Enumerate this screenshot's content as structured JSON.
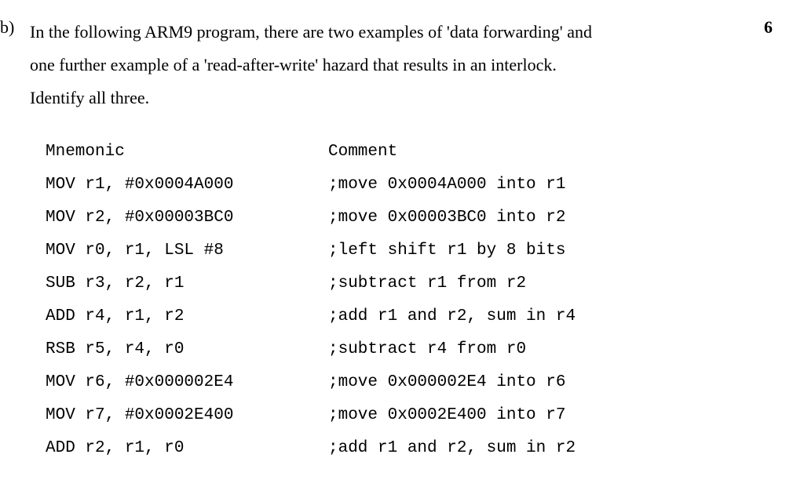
{
  "question": {
    "label": "b)",
    "marks": "6",
    "lines": [
      "In the following ARM9 program, there are two examples of 'data forwarding' and",
      "one further example of a 'read-after-write' hazard that results in an interlock.",
      "Identify all three."
    ]
  },
  "code": {
    "header": {
      "mnemonic": "Mnemonic",
      "comment": "Comment"
    },
    "rows": [
      {
        "mnemonic": "MOV r1, #0x0004A000",
        "comment": ";move 0x0004A000 into r1"
      },
      {
        "mnemonic": "MOV r2, #0x00003BC0",
        "comment": ";move 0x00003BC0 into r2"
      },
      {
        "mnemonic": "MOV r0, r1, LSL #8",
        "comment": ";left shift r1 by 8 bits"
      },
      {
        "mnemonic": "SUB r3, r2, r1",
        "comment": ";subtract r1 from r2"
      },
      {
        "mnemonic": "ADD r4, r1, r2",
        "comment": ";add r1 and r2, sum in r4"
      },
      {
        "mnemonic": "RSB r5, r4, r0",
        "comment": ";subtract r4 from r0"
      },
      {
        "mnemonic": "MOV r6, #0x000002E4",
        "comment": ";move 0x000002E4 into r6"
      },
      {
        "mnemonic": "MOV r7, #0x0002E400",
        "comment": ";move 0x0002E400 into r7"
      },
      {
        "mnemonic": "ADD r2, r1, r0",
        "comment": ";add r1 and r2, sum in r2"
      }
    ]
  }
}
